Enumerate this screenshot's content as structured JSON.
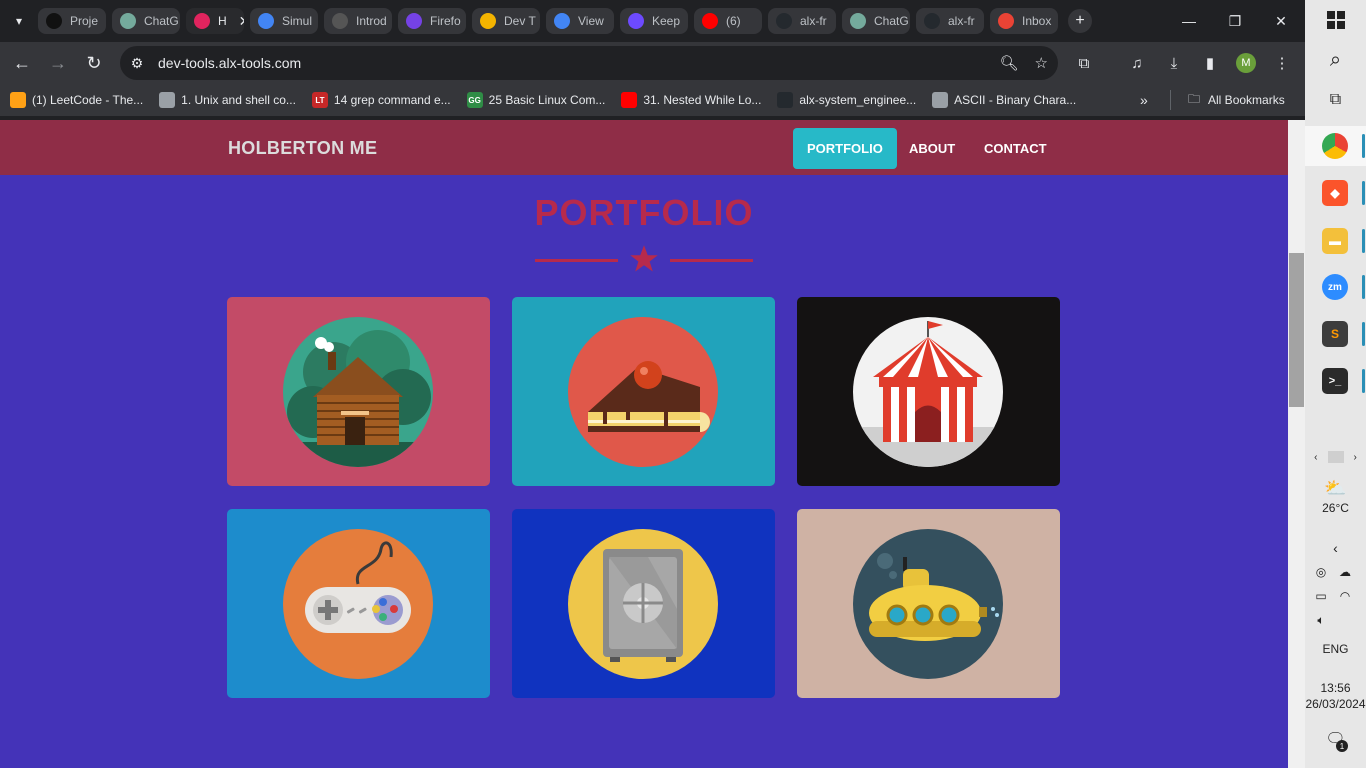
{
  "browser": {
    "tabs": [
      {
        "title": "Proje",
        "favicon": "alx-icon",
        "color": "#111111"
      },
      {
        "title": "ChatG",
        "favicon": "chatgpt-icon",
        "color": "#74aa9c"
      },
      {
        "title": "H",
        "favicon": "holberton-icon",
        "color": "#e0245e",
        "active": true
      },
      {
        "title": "Simul",
        "favicon": "chrome-icon",
        "color": "#4285f4"
      },
      {
        "title": "Introd",
        "favicon": "page-icon",
        "color": "#555555"
      },
      {
        "title": "Firefo",
        "favicon": "firefox-icon",
        "color": "#7542e5"
      },
      {
        "title": "Dev T",
        "favicon": "udemy-icon",
        "color": "#f4b400"
      },
      {
        "title": "View",
        "favicon": "chrome-icon",
        "color": "#4285f4"
      },
      {
        "title": "Keep",
        "favicon": "proton-icon",
        "color": "#6d4aff"
      },
      {
        "title": "(6)",
        "favicon": "youtube-icon",
        "color": "#ff0000"
      },
      {
        "title": "alx-fr",
        "favicon": "github-icon",
        "color": "#24292e"
      },
      {
        "title": "ChatG",
        "favicon": "chatgpt-icon",
        "color": "#74aa9c"
      },
      {
        "title": "alx-fr",
        "favicon": "github-icon",
        "color": "#24292e"
      },
      {
        "title": "Inbox",
        "favicon": "gmail-icon",
        "color": "#ea4335"
      }
    ],
    "url": "dev-tools.alx-tools.com",
    "profile_initial": "M",
    "bookmarks": [
      {
        "label": "(1) LeetCode - The...",
        "icon": "leetcode-icon",
        "color": "#ffa116"
      },
      {
        "label": "1. Unix and shell co...",
        "icon": "globe-icon",
        "color": "#9aa0a6"
      },
      {
        "label": "14 grep command e...",
        "icon": "lt-icon",
        "color": "#c62828",
        "glyph": "LT"
      },
      {
        "label": "25 Basic Linux Com...",
        "icon": "gfg-icon",
        "color": "#2f8d46",
        "glyph": "GG"
      },
      {
        "label": "31. Nested While Lo...",
        "icon": "youtube-icon",
        "color": "#ff0000"
      },
      {
        "label": "alx-system_enginee...",
        "icon": "github-icon",
        "color": "#24292e"
      },
      {
        "label": "ASCII - Binary Chara...",
        "icon": "globe-icon",
        "color": "#9aa0a6"
      }
    ],
    "all_bookmarks_label": "All Bookmarks"
  },
  "site": {
    "brand": "HOLBERTON ME",
    "nav": [
      {
        "label": "PORTFOLIO",
        "active": true
      },
      {
        "label": "ABOUT",
        "active": false
      },
      {
        "label": "CONTACT",
        "active": false
      }
    ],
    "section_title": "PORTFOLIO",
    "accent_color": "#b72a4c",
    "nav_color": "#8f2d47",
    "background_color": "#4433b8",
    "portfolio": [
      {
        "item": "cabin",
        "bg": "#c34b67"
      },
      {
        "item": "cake",
        "bg": "#21a3bb"
      },
      {
        "item": "circus",
        "bg": "#141212"
      },
      {
        "item": "game-controller",
        "bg": "#1d8ccc"
      },
      {
        "item": "safe",
        "bg": "#1033bf"
      },
      {
        "item": "submarine",
        "bg": "#cfb2a4"
      }
    ]
  },
  "taskbar": {
    "weather": "26°C",
    "language": "ENG",
    "time": "13:56",
    "date": "26/03/2024",
    "notification_count": "1"
  }
}
